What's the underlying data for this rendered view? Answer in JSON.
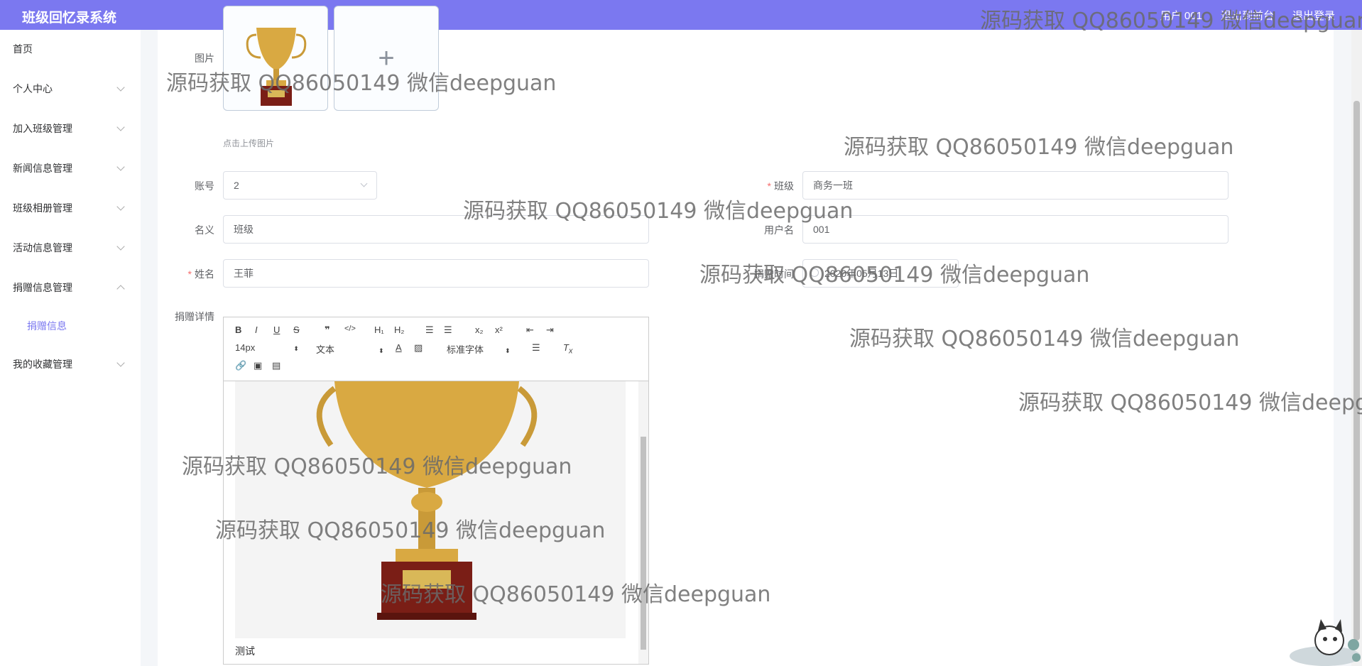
{
  "app": {
    "title": "班级回忆录系统"
  },
  "header": {
    "user": "用户 001",
    "backend_link": "退出到前台",
    "logout": "退出登录"
  },
  "sidebar": {
    "items": [
      {
        "label": "首页",
        "expandable": false
      },
      {
        "label": "个人中心",
        "expandable": true
      },
      {
        "label": "加入班级管理",
        "expandable": true
      },
      {
        "label": "新闻信息管理",
        "expandable": true
      },
      {
        "label": "班级相册管理",
        "expandable": true
      },
      {
        "label": "活动信息管理",
        "expandable": true
      },
      {
        "label": "捐赠信息管理",
        "expandable": true,
        "expanded": true
      },
      {
        "label": "我的收藏管理",
        "expandable": true
      }
    ],
    "sub_item": "捐赠信息"
  },
  "form": {
    "image_label": "图片",
    "upload_hint": "点击上传图片",
    "account_label": "账号",
    "account_value": "2",
    "class_label": "班级",
    "class_value": "商务一班",
    "title_label": "名义",
    "title_value": "班级",
    "username_label": "用户名",
    "username_value": "001",
    "name_label": "姓名",
    "name_value": "王菲",
    "time_label": "捐赠时间",
    "time_value": "2020年05月13日",
    "detail_label": "捐赠详情"
  },
  "editor": {
    "font_size": "14px",
    "block_type": "文本",
    "font_family": "标准字体",
    "content_text": "测试"
  },
  "watermark": "源码获取 QQ86050149 微信deepguan",
  "colors": {
    "header": "#7b78f0",
    "active": "#7b78f0",
    "required": "#f56c6c"
  }
}
